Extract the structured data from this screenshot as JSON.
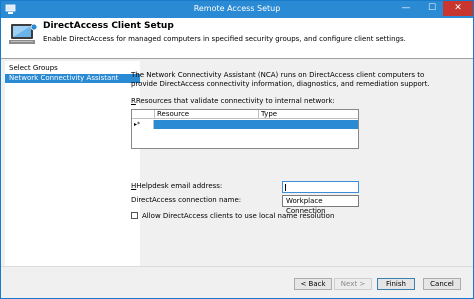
{
  "window": {
    "title": "Remote Access Setup"
  },
  "caption": {
    "minimize": "—",
    "maximize": "☐",
    "close": "✕"
  },
  "header": {
    "title": "DirectAccess Client Setup",
    "description": "Enable DirectAccess for managed computers in specified security groups, and configure client settings."
  },
  "nav": {
    "items": [
      {
        "label": "Select Groups",
        "selected": false
      },
      {
        "label": "Network Connectivity Assistant",
        "selected": true
      }
    ]
  },
  "content": {
    "intro": "The Network Connectivity Assistant (NCA) runs on DirectAccess client computers to provide DirectAccess connectivity information, diagnostics, and remediation support.",
    "resources_label": "Resources that validate connectivity to internal network:",
    "grid": {
      "columns": [
        "Resource",
        "Type"
      ],
      "new_row_marker": "▸*"
    },
    "helpdesk_label": "Helpdesk email address:",
    "helpdesk_value": "",
    "connection_label": "DirectAccess connection name:",
    "connection_value": "Workplace Connection",
    "local_name_label": "Allow DirectAccess clients to use local name resolution",
    "local_name_checked": false
  },
  "footer": {
    "back": "< Back",
    "next": "Next >",
    "finish": "Finish",
    "cancel": "Cancel"
  }
}
